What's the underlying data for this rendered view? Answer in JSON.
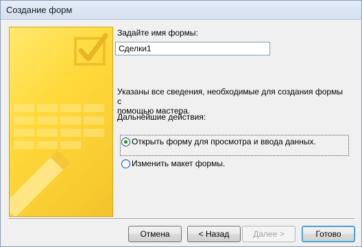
{
  "window": {
    "title": "Создание форм"
  },
  "form": {
    "name_prompt": "Задайте имя формы:",
    "name_value": "Сделки1",
    "info_line1": "Указаны все сведения, необходимые для создания формы с",
    "info_line2": "помощью мастера.",
    "next_actions_label": "Дальнейшие действия:",
    "options": [
      {
        "label": "Открыть форму для просмотра и ввода данных.",
        "selected": true
      },
      {
        "label": "Изменить макет формы.",
        "selected": false
      }
    ]
  },
  "buttons": {
    "cancel": "Отмена",
    "back": "< Назад",
    "next": "Далее >",
    "finish": "Готово"
  },
  "colors": {
    "banner": "#ffd93a",
    "accent": "#3c7fb1"
  }
}
